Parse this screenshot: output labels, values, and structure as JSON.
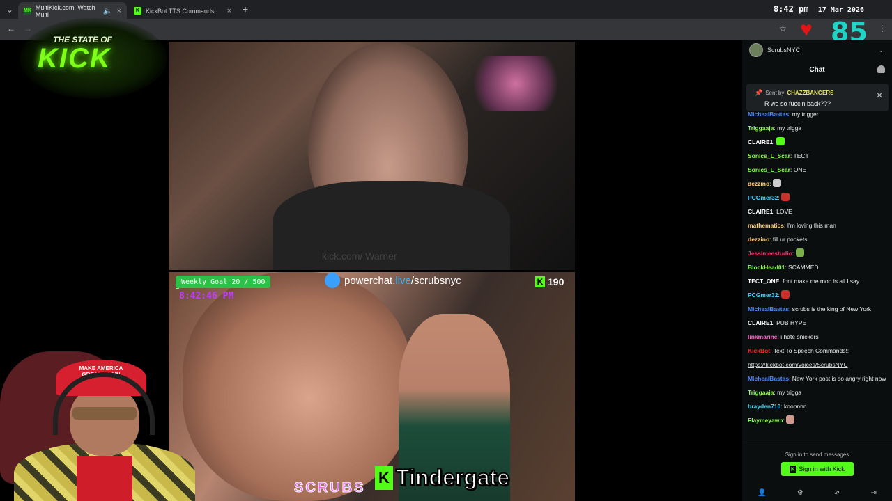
{
  "browser": {
    "tabs": [
      {
        "label": "MultiKick.com: Watch Multi",
        "favicon": "MK",
        "active": true
      },
      {
        "label": "KickBot TTS Commands",
        "favicon": "K",
        "active": false
      }
    ],
    "new_tab": "+",
    "clock_time": "8:42 pm",
    "clock_date": "17 Mar 2026"
  },
  "overlay": {
    "logo_line1": "THE STATE OF",
    "logo_line2": "KICK",
    "viewer_count": "85",
    "goal_text": "Weekly Goal 20 / 500",
    "goal_progress": 0.04,
    "timestamp": "8:42:46 PM",
    "powerchat_prefix": "powerchat.",
    "powerchat_live": "live",
    "powerchat_suffix": "/scrubsnyc",
    "k_count": "190",
    "subtitle_word": "Tindergate",
    "subtitle_k": "K",
    "scrubs_text": "SCRUBS",
    "hat_text": "MAKE AMERICA GREAT AGAIN",
    "video_watermark": "kick.com/ Warner"
  },
  "chat": {
    "channel": "ScrubsNYC",
    "title": "Chat",
    "pinned_sent_by": "Sent by",
    "pinned_user": "CHAZZBANGERS",
    "pinned_message": "R we so fuccin back???",
    "messages": [
      {
        "user": "MichealBastas",
        "color": "#4a8cff",
        "text": "my trigger"
      },
      {
        "user": "Triggaaja",
        "color": "#8bff4a",
        "text": "my trigga"
      },
      {
        "user": "CLAIRE1",
        "color": "#ffffff",
        "text": "",
        "emote": "#53fc18"
      },
      {
        "user": "Sonics_L_Scar",
        "color": "#8bff4a",
        "text": "TECT"
      },
      {
        "user": "Sonics_L_Scar",
        "color": "#8bff4a",
        "text": "ONE"
      },
      {
        "user": "dezzino",
        "color": "#ffcf7a",
        "text": "",
        "emote": "#cccccc"
      },
      {
        "user": "PCGmer32",
        "color": "#4acfff",
        "text": "",
        "emote": "#c8322a"
      },
      {
        "user": "CLAIRE1",
        "color": "#ffffff",
        "text": "LOVE"
      },
      {
        "user": "mathematics",
        "color": "#ffcf7a",
        "text": "I'm loving this man"
      },
      {
        "user": "dezzino",
        "color": "#ffcf7a",
        "text": "fill ur pockets"
      },
      {
        "user": "Jessimeestudio",
        "color": "#ff2a6a",
        "text": "",
        "emote": "#7ab04a"
      },
      {
        "user": "BlockHead01",
        "color": "#8bff4a",
        "text": "SCAMMED"
      },
      {
        "user": "TECT_ONE",
        "color": "#ffffff",
        "text": "font make me mod is all I say"
      },
      {
        "user": "PCGmer32",
        "color": "#4acfff",
        "text": "",
        "emote": "#c8322a"
      },
      {
        "user": "MichealBastas",
        "color": "#4a8cff",
        "text": "scrubs is the king of New York"
      },
      {
        "user": "CLAIRE1",
        "color": "#ffffff",
        "text": "PUB HYPE"
      },
      {
        "user": "linkmarine",
        "color": "#ff6ad0",
        "text": "i hate snickers"
      },
      {
        "user": "KickBot",
        "color": "#ff2a2a",
        "text": "Text To Speech Commands!:"
      },
      {
        "user": "",
        "color": "#ffffff",
        "text": "",
        "link": "https://kickbot.com/voices/ScrubsNYC"
      },
      {
        "user": "MichealBastas",
        "color": "#4a8cff",
        "text": "New York post is so angry right now",
        "wrap": true
      },
      {
        "user": "Triggaaja",
        "color": "#8bff4a",
        "text": "my trigga"
      },
      {
        "user": "brayden710",
        "color": "#4acfff",
        "text": "koonnnn"
      },
      {
        "user": "Flaymeyawn",
        "color": "#8bff4a",
        "text": "",
        "emote": "#d09a90"
      }
    ],
    "signin_prompt": "Sign in to send messages",
    "signin_button": "Sign in with Kick"
  }
}
